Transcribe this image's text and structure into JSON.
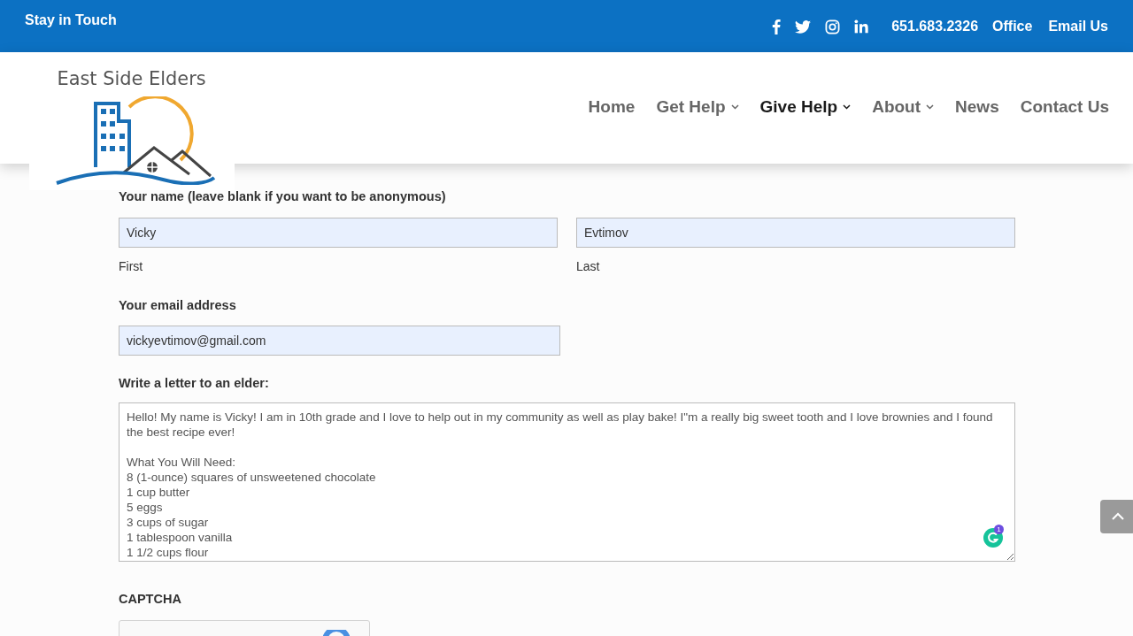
{
  "top_bar": {
    "title": "Stay in Touch",
    "phone": "651.683.2326",
    "links": [
      "Office",
      "Email Us"
    ]
  },
  "logo": {
    "text": "East Side Elders"
  },
  "nav": [
    {
      "label": "Home",
      "selected": false,
      "dropdown": false
    },
    {
      "label": "Get Help",
      "selected": false,
      "dropdown": true
    },
    {
      "label": "Give Help",
      "selected": true,
      "dropdown": true
    },
    {
      "label": "About",
      "selected": false,
      "dropdown": true
    },
    {
      "label": "News",
      "selected": false,
      "dropdown": false
    },
    {
      "label": "Contact Us",
      "selected": false,
      "dropdown": false
    }
  ],
  "form": {
    "name_label": "Your name (leave blank if you want to be anonymous)",
    "first": {
      "value": "Vicky",
      "caption": "First"
    },
    "last": {
      "value": "Evtimov",
      "caption": "Last"
    },
    "email_label": "Your email address",
    "email": "vickyevtimov@gmail.com",
    "letter_label": "Write a letter to an elder:",
    "letter": "Hello! My name is Vicky! I am in 10th grade and I love to help out in my community as well as play bake! I\"m a really big sweet tooth and I love brownies and I found the best recipe ever!\n\nWhat You Will Need:\n8 (1-ounce) squares of unsweetened chocolate\n1 cup butter\n5 eggs\n3 cups of sugar\n1 tablespoon vanilla\n1 1/2 cups flour",
    "grammar_badge": "1",
    "captcha_label": "CAPTCHA"
  }
}
